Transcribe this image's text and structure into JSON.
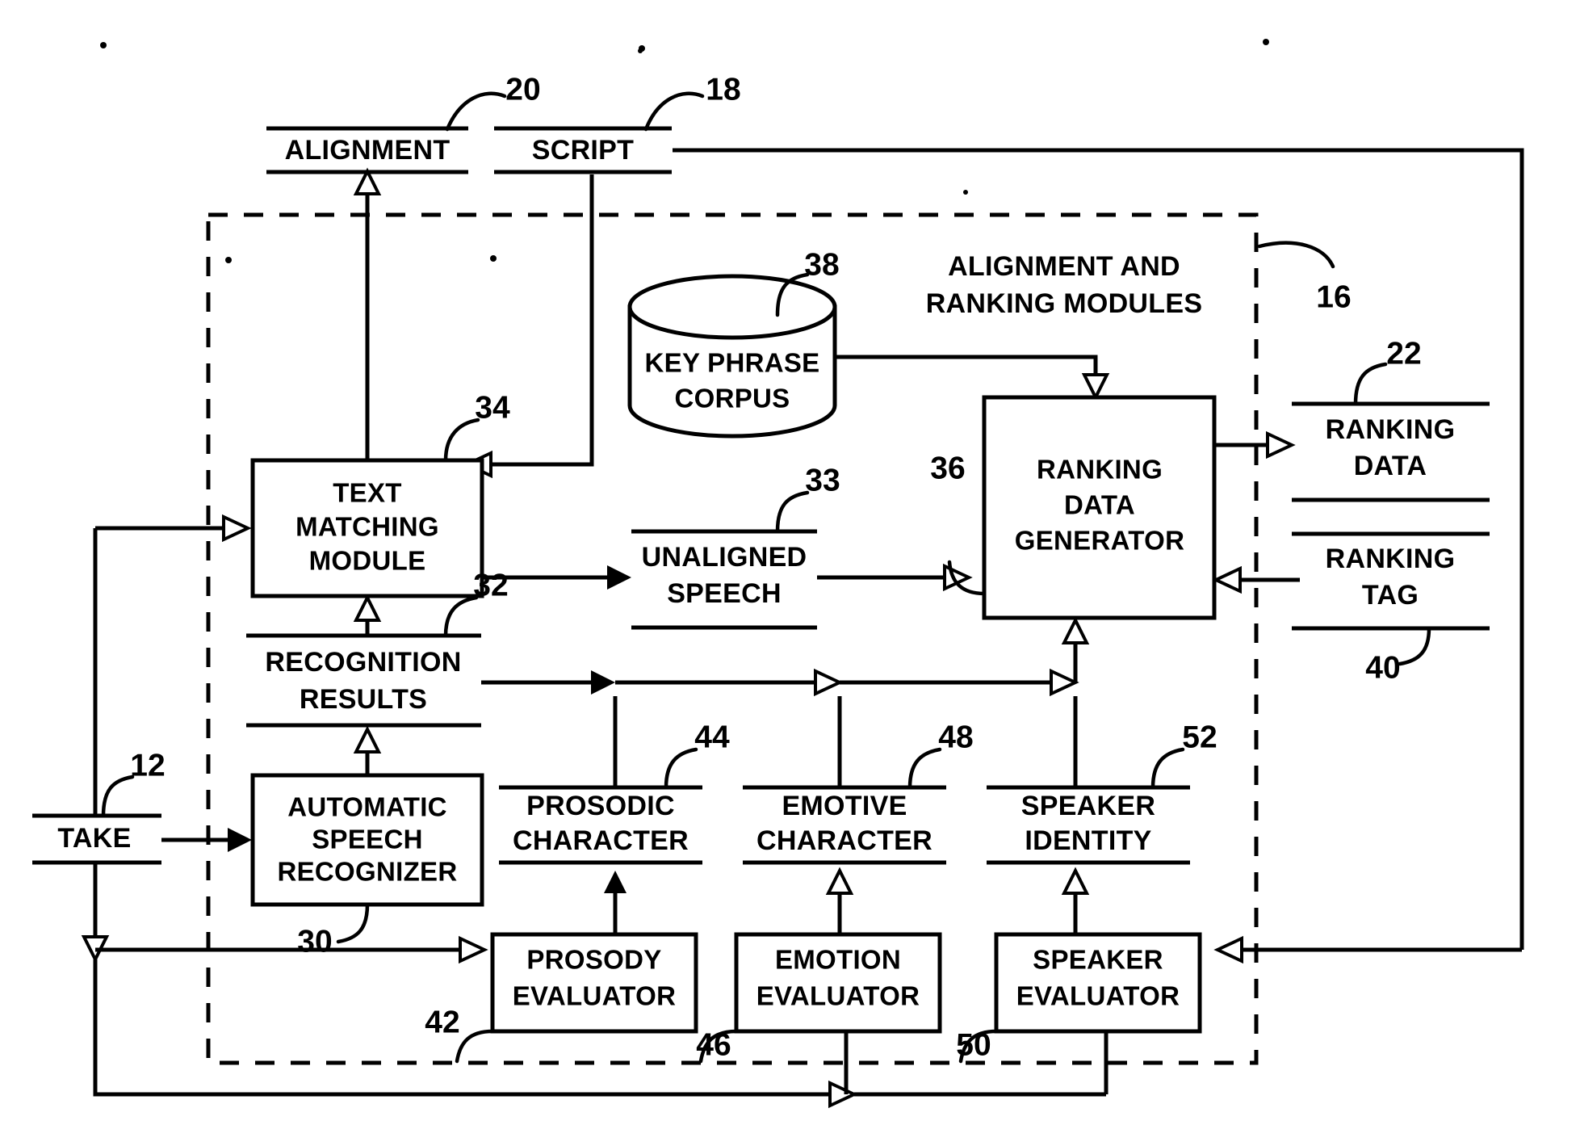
{
  "figure": {
    "type": "patent-block-diagram",
    "background": "#ffffff",
    "ink": "#000000",
    "enclosure": {
      "name": "alignment-and-ranking-modules",
      "title_line1": "ALIGNMENT AND",
      "title_line2": "RANKING MODULES",
      "ref": "16",
      "style": "dashed"
    }
  },
  "open_labels": [
    {
      "id": "alignment",
      "text": "ALIGNMENT",
      "ref": "20"
    },
    {
      "id": "script",
      "text": "SCRIPT",
      "ref": "18"
    },
    {
      "id": "ranking_data",
      "line1": "RANKING",
      "line2": "DATA",
      "ref": "22"
    },
    {
      "id": "ranking_tag",
      "line1": "RANKING",
      "line2": "TAG",
      "ref": "40"
    },
    {
      "id": "unaligned_speech",
      "line1": "UNALIGNED",
      "line2": "SPEECH",
      "ref": "33"
    },
    {
      "id": "recognition_results",
      "line1": "RECOGNITION",
      "line2": "RESULTS",
      "ref": "32"
    },
    {
      "id": "take",
      "text": "TAKE",
      "ref": "12"
    },
    {
      "id": "prosodic_character",
      "line1": "PROSODIC",
      "line2": "CHARACTER",
      "ref": "44"
    },
    {
      "id": "emotive_character",
      "line1": "EMOTIVE",
      "line2": "CHARACTER",
      "ref": "48"
    },
    {
      "id": "speaker_identity",
      "line1": "SPEAKER",
      "line2": "IDENTITY",
      "ref": "52"
    }
  ],
  "boxes": [
    {
      "id": "text_matching_module",
      "line1": "TEXT",
      "line2": "MATCHING",
      "line3": "MODULE",
      "ref": "34"
    },
    {
      "id": "ranking_data_generator",
      "line1": "RANKING",
      "line2": "DATA",
      "line3": "GENERATOR",
      "ref": "36"
    },
    {
      "id": "automatic_speech_recognizer",
      "line1": "AUTOMATIC",
      "line2": "SPEECH",
      "line3": "RECOGNIZER",
      "ref": "30"
    },
    {
      "id": "prosody_evaluator",
      "line1": "PROSODY",
      "line2": "EVALUATOR",
      "ref": "42"
    },
    {
      "id": "emotion_evaluator",
      "line1": "EMOTION",
      "line2": "EVALUATOR",
      "ref": "46"
    },
    {
      "id": "speaker_evaluator",
      "line1": "SPEAKER",
      "line2": "EVALUATOR",
      "ref": "50"
    }
  ],
  "datastores": [
    {
      "id": "key_phrase_corpus",
      "line1": "KEY PHRASE",
      "line2": "CORPUS",
      "ref": "38"
    }
  ],
  "reference_numerals": [
    "12",
    "16",
    "18",
    "20",
    "22",
    "30",
    "32",
    "33",
    "34",
    "36",
    "38",
    "40",
    "42",
    "44",
    "46",
    "48",
    "50",
    "52"
  ]
}
